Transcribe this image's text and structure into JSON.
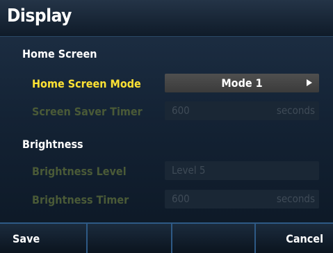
{
  "header": {
    "title": "Display"
  },
  "sections": {
    "home_screen": {
      "label": "Home Screen",
      "mode": {
        "label": "Home Screen Mode",
        "value": "Mode 1"
      },
      "saver": {
        "label": "Screen Saver Timer",
        "value": "600",
        "unit": "seconds"
      }
    },
    "brightness": {
      "label": "Brightness",
      "level": {
        "label": "Brightness Level",
        "value": "Level 5"
      },
      "timer": {
        "label": "Brightness Timer",
        "value": "600",
        "unit": "seconds"
      }
    }
  },
  "softkeys": {
    "save": "Save",
    "key2": "",
    "key3": "",
    "cancel": "Cancel"
  },
  "colors": {
    "highlight": "#ffe234",
    "disabled_label": "#4a5a37",
    "background": "#142335",
    "separator": "#2e5a86"
  }
}
